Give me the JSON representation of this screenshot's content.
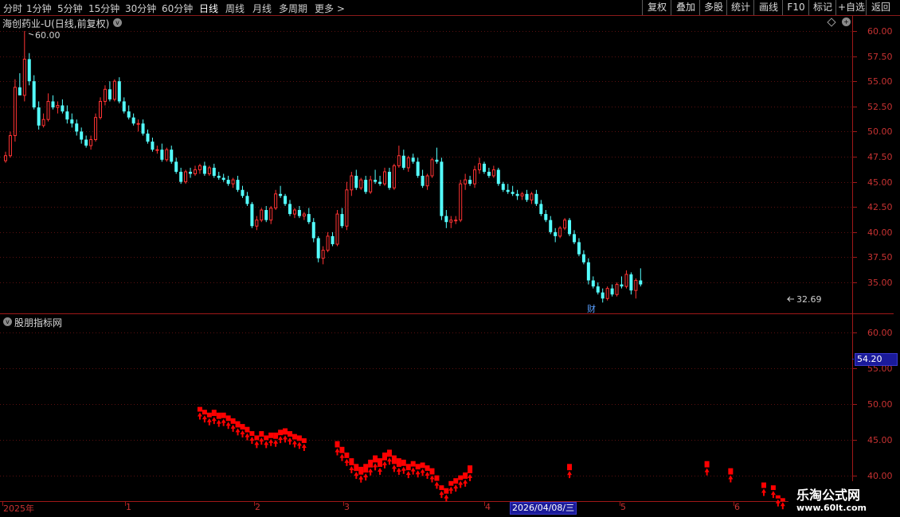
{
  "toolbar": {
    "periods": [
      "分时",
      "1分钟",
      "5分钟",
      "15分钟",
      "30分钟",
      "60分钟",
      "日线",
      "周线",
      "月线",
      "多周期",
      "更多 >"
    ],
    "active_period": "日线",
    "right_buttons": [
      "复权",
      "叠加",
      "多股",
      "统计",
      "画线",
      "F10",
      "标记",
      "+自选",
      "返回"
    ]
  },
  "stock": {
    "name": "海创药业-U(日线,前复权)"
  },
  "indicator": {
    "name": "股朋指标网"
  },
  "annotations": {
    "high": "60.00",
    "low": "32.69",
    "financial_mark": "财"
  },
  "crosshair": {
    "date": "2026/04/08/三",
    "value": "54.20"
  },
  "watermark": {
    "line1": "乐淘公式网",
    "line2": "www.60lt.com"
  },
  "colors": {
    "up": "#ff3333",
    "down": "#54ffff",
    "signal": "#ff0000",
    "axis": "#a01818"
  },
  "chart_data": [
    {
      "type": "candlestick",
      "title": "海创药业-U(日线,前复权)",
      "y_ticks": [
        60.0,
        57.5,
        55.0,
        52.5,
        50.0,
        47.5,
        45.0,
        42.5,
        40.0,
        37.5,
        35.0
      ],
      "ylim": [
        32.0,
        61.5
      ],
      "x_labels": [
        "2025年",
        "1",
        "2",
        "3",
        "4",
        "5",
        "6"
      ],
      "high": 60.0,
      "low": 32.69,
      "candles": [
        [
          47.1,
          48.0,
          46.9,
          47.6
        ],
        [
          47.6,
          50.0,
          47.4,
          49.6
        ],
        [
          49.6,
          55.2,
          49.0,
          54.4
        ],
        [
          54.4,
          55.8,
          53.6,
          53.6
        ],
        [
          53.6,
          60.0,
          53.0,
          57.2
        ],
        [
          57.2,
          57.8,
          54.6,
          55.0
        ],
        [
          55.0,
          55.6,
          52.2,
          52.4
        ],
        [
          52.4,
          53.0,
          50.2,
          50.6
        ],
        [
          50.6,
          51.8,
          50.4,
          51.2
        ],
        [
          51.2,
          53.8,
          51.0,
          53.0
        ],
        [
          53.0,
          53.6,
          52.2,
          52.4
        ],
        [
          52.4,
          53.0,
          51.8,
          52.6
        ],
        [
          52.6,
          53.2,
          51.8,
          52.0
        ],
        [
          52.0,
          52.6,
          50.8,
          51.2
        ],
        [
          51.2,
          51.8,
          50.4,
          50.8
        ],
        [
          50.8,
          51.2,
          49.6,
          50.0
        ],
        [
          50.0,
          50.4,
          48.8,
          49.2
        ],
        [
          49.2,
          49.6,
          48.4,
          48.6
        ],
        [
          48.6,
          49.6,
          48.2,
          49.2
        ],
        [
          49.2,
          51.8,
          49.0,
          51.4
        ],
        [
          51.4,
          53.4,
          51.2,
          53.0
        ],
        [
          53.0,
          54.6,
          52.6,
          54.2
        ],
        [
          54.2,
          55.0,
          53.0,
          53.2
        ],
        [
          53.2,
          55.2,
          53.0,
          55.0
        ],
        [
          55.0,
          55.4,
          52.8,
          53.0
        ],
        [
          53.0,
          53.4,
          51.8,
          52.0
        ],
        [
          52.0,
          52.6,
          51.2,
          51.4
        ],
        [
          51.4,
          51.8,
          50.6,
          50.8
        ],
        [
          50.8,
          51.2,
          50.0,
          50.8
        ],
        [
          50.8,
          51.2,
          49.6,
          49.8
        ],
        [
          49.8,
          50.2,
          48.8,
          49.0
        ],
        [
          49.0,
          49.4,
          48.0,
          48.2
        ],
        [
          48.2,
          48.6,
          47.8,
          48.2
        ],
        [
          48.2,
          48.8,
          47.0,
          47.2
        ],
        [
          47.2,
          48.4,
          47.0,
          48.2
        ],
        [
          48.2,
          48.6,
          46.8,
          47.0
        ],
        [
          47.0,
          47.4,
          45.8,
          46.0
        ],
        [
          46.0,
          46.4,
          44.8,
          45.0
        ],
        [
          45.0,
          46.2,
          44.8,
          46.0
        ],
        [
          46.0,
          46.4,
          45.4,
          45.8
        ],
        [
          45.8,
          46.6,
          45.6,
          46.2
        ],
        [
          46.2,
          46.8,
          45.8,
          46.6
        ],
        [
          46.6,
          47.0,
          45.6,
          45.8
        ],
        [
          45.8,
          46.6,
          45.6,
          46.4
        ],
        [
          46.4,
          46.8,
          45.4,
          45.6
        ],
        [
          45.6,
          46.0,
          45.2,
          45.4
        ],
        [
          45.4,
          45.8,
          45.0,
          45.2
        ],
        [
          45.2,
          45.6,
          44.6,
          44.8
        ],
        [
          44.8,
          45.4,
          44.4,
          45.2
        ],
        [
          45.2,
          45.6,
          44.0,
          44.2
        ],
        [
          44.2,
          44.6,
          43.4,
          43.6
        ],
        [
          43.6,
          44.0,
          42.6,
          42.8
        ],
        [
          42.8,
          43.0,
          40.4,
          40.6
        ],
        [
          40.6,
          41.6,
          40.2,
          41.2
        ],
        [
          41.2,
          42.4,
          41.0,
          42.2
        ],
        [
          42.2,
          42.6,
          41.0,
          41.2
        ],
        [
          41.2,
          42.6,
          40.8,
          42.4
        ],
        [
          42.4,
          44.2,
          42.2,
          43.8
        ],
        [
          43.8,
          44.6,
          43.4,
          43.6
        ],
        [
          43.6,
          43.8,
          42.6,
          42.8
        ],
        [
          42.8,
          43.2,
          41.6,
          41.8
        ],
        [
          41.8,
          42.4,
          41.4,
          42.2
        ],
        [
          42.2,
          42.6,
          41.4,
          41.6
        ],
        [
          41.6,
          42.0,
          41.2,
          41.8
        ],
        [
          41.8,
          42.4,
          40.8,
          41.0
        ],
        [
          41.0,
          41.4,
          39.0,
          39.4
        ],
        [
          39.4,
          39.6,
          37.0,
          37.4
        ],
        [
          37.4,
          38.6,
          36.8,
          38.2
        ],
        [
          38.2,
          40.0,
          38.0,
          39.6
        ],
        [
          39.6,
          40.0,
          38.6,
          38.8
        ],
        [
          38.8,
          42.2,
          38.6,
          41.8
        ],
        [
          41.8,
          42.4,
          40.4,
          40.6
        ],
        [
          40.6,
          45.0,
          40.2,
          44.2
        ],
        [
          44.2,
          46.0,
          43.6,
          45.6
        ],
        [
          45.6,
          46.2,
          44.2,
          44.4
        ],
        [
          44.4,
          45.4,
          44.2,
          45.2
        ],
        [
          45.2,
          45.6,
          43.8,
          44.0
        ],
        [
          44.0,
          45.6,
          43.8,
          45.2
        ],
        [
          45.2,
          46.2,
          44.8,
          45.0
        ],
        [
          45.0,
          45.6,
          44.6,
          44.8
        ],
        [
          44.8,
          46.4,
          44.6,
          46.0
        ],
        [
          46.0,
          46.4,
          44.2,
          44.4
        ],
        [
          44.4,
          46.8,
          44.2,
          46.6
        ],
        [
          46.6,
          48.6,
          46.4,
          47.6
        ],
        [
          47.6,
          48.2,
          46.2,
          46.4
        ],
        [
          46.4,
          47.6,
          46.0,
          47.4
        ],
        [
          47.4,
          47.8,
          46.8,
          47.0
        ],
        [
          47.0,
          47.4,
          45.4,
          45.6
        ],
        [
          45.6,
          46.2,
          44.4,
          44.6
        ],
        [
          44.6,
          45.8,
          44.2,
          45.6
        ],
        [
          45.6,
          47.4,
          45.4,
          47.2
        ],
        [
          47.2,
          48.4,
          46.8,
          47.0
        ],
        [
          47.0,
          47.4,
          41.2,
          41.6
        ],
        [
          41.6,
          42.2,
          40.4,
          41.0
        ],
        [
          41.0,
          41.6,
          40.4,
          41.2
        ],
        [
          41.2,
          41.6,
          40.8,
          41.2
        ],
        [
          41.2,
          45.2,
          41.0,
          44.8
        ],
        [
          44.8,
          45.8,
          44.2,
          45.2
        ],
        [
          45.2,
          45.6,
          44.6,
          44.8
        ],
        [
          44.8,
          46.6,
          44.4,
          46.2
        ],
        [
          46.2,
          47.4,
          45.8,
          46.8
        ],
        [
          46.8,
          47.0,
          45.8,
          46.0
        ],
        [
          46.0,
          46.4,
          45.4,
          45.6
        ],
        [
          45.6,
          46.6,
          45.4,
          46.2
        ],
        [
          46.2,
          46.4,
          44.6,
          44.8
        ],
        [
          44.8,
          45.0,
          44.0,
          44.2
        ],
        [
          44.2,
          44.8,
          43.8,
          44.0
        ],
        [
          44.0,
          44.6,
          43.6,
          43.8
        ],
        [
          43.8,
          44.2,
          43.2,
          43.6
        ],
        [
          43.6,
          44.0,
          43.2,
          43.8
        ],
        [
          43.8,
          44.2,
          43.0,
          43.2
        ],
        [
          43.2,
          44.0,
          42.8,
          43.8
        ],
        [
          43.8,
          44.2,
          42.6,
          42.8
        ],
        [
          42.8,
          43.2,
          41.6,
          41.8
        ],
        [
          41.8,
          42.2,
          41.0,
          41.2
        ],
        [
          41.2,
          41.6,
          39.8,
          40.0
        ],
        [
          40.0,
          40.4,
          39.0,
          39.6
        ],
        [
          39.6,
          40.6,
          39.4,
          40.4
        ],
        [
          40.4,
          41.4,
          40.2,
          41.2
        ],
        [
          41.2,
          41.4,
          39.6,
          39.8
        ],
        [
          39.8,
          40.2,
          38.8,
          39.0
        ],
        [
          39.0,
          39.4,
          37.6,
          37.8
        ],
        [
          37.8,
          38.2,
          36.8,
          37.0
        ],
        [
          37.0,
          37.4,
          34.8,
          35.2
        ],
        [
          35.2,
          35.6,
          34.4,
          34.6
        ],
        [
          34.6,
          35.0,
          33.8,
          34.0
        ],
        [
          34.0,
          34.4,
          33.0,
          33.4
        ],
        [
          33.4,
          34.6,
          33.2,
          34.4
        ],
        [
          34.4,
          34.8,
          33.6,
          33.8
        ],
        [
          33.8,
          35.0,
          33.6,
          34.8
        ],
        [
          34.8,
          35.6,
          34.4,
          34.6
        ],
        [
          34.6,
          36.2,
          34.4,
          35.8
        ],
        [
          35.8,
          36.0,
          33.8,
          34.2
        ],
        [
          34.2,
          35.4,
          33.4,
          35.2
        ],
        [
          35.2,
          36.4,
          34.6,
          34.8
        ]
      ]
    },
    {
      "type": "signal",
      "title": "股朋指标网",
      "y_ticks": [
        60.0,
        55.0,
        50.0,
        45.0,
        40.0
      ],
      "ylim": [
        36.5,
        62.5
      ],
      "marks": [
        [
          41,
          49.6,
          48.4
        ],
        [
          42,
          49.2,
          48.0
        ],
        [
          43,
          48.8,
          47.6
        ],
        [
          44,
          49.2,
          47.6
        ],
        [
          45,
          48.8,
          47.2
        ],
        [
          46,
          48.8,
          47.4
        ],
        [
          47,
          48.4,
          47.0
        ],
        [
          48,
          48.0,
          46.6
        ],
        [
          49,
          47.6,
          46.0
        ],
        [
          50,
          47.2,
          45.8
        ],
        [
          51,
          46.8,
          45.4
        ],
        [
          52,
          46.2,
          45.0
        ],
        [
          53,
          45.6,
          44.4
        ],
        [
          54,
          46.2,
          44.8
        ],
        [
          55,
          45.6,
          44.4
        ],
        [
          56,
          46.0,
          44.6
        ],
        [
          57,
          46.0,
          44.4
        ],
        [
          58,
          46.4,
          45.0
        ],
        [
          59,
          46.6,
          45.0
        ],
        [
          60,
          46.2,
          44.8
        ],
        [
          61,
          45.8,
          44.4
        ],
        [
          62,
          45.6,
          44.2
        ],
        [
          63,
          45.2,
          44.0
        ],
        [
          70,
          44.8,
          43.2
        ],
        [
          71,
          44.0,
          42.4
        ],
        [
          72,
          43.2,
          41.8
        ],
        [
          73,
          42.4,
          40.6
        ],
        [
          74,
          41.6,
          39.8
        ],
        [
          75,
          41.2,
          39.2
        ],
        [
          76,
          41.6,
          39.4
        ],
        [
          77,
          42.2,
          40.2
        ],
        [
          78,
          42.8,
          41.0
        ],
        [
          79,
          42.4,
          40.2
        ],
        [
          80,
          43.2,
          41.2
        ],
        [
          81,
          43.6,
          41.8
        ],
        [
          82,
          42.8,
          40.6
        ],
        [
          83,
          42.4,
          40.2
        ],
        [
          84,
          42.2,
          40.6
        ],
        [
          85,
          41.6,
          40.0
        ],
        [
          86,
          42.0,
          40.6
        ],
        [
          87,
          41.6,
          40.2
        ],
        [
          88,
          41.8,
          40.4
        ],
        [
          89,
          41.4,
          40.0
        ],
        [
          90,
          41.0,
          39.4
        ],
        [
          91,
          40.0,
          38.6
        ],
        [
          92,
          38.6,
          37.4
        ],
        [
          93,
          38.2,
          36.8
        ],
        [
          94,
          39.2,
          38.0
        ],
        [
          95,
          39.6,
          38.2
        ],
        [
          96,
          40.0,
          38.8
        ],
        [
          97,
          40.4,
          38.8
        ],
        [
          98,
          41.4,
          39.4
        ],
        [
          119,
          41.6,
          40.0
        ],
        [
          148,
          42.0,
          40.4
        ],
        [
          153,
          41.0,
          39.4
        ],
        [
          160,
          39.0,
          37.6
        ],
        [
          162,
          38.6,
          37.4
        ],
        [
          163,
          37.2,
          36.6
        ],
        [
          164,
          36.8,
          36.2
        ]
      ]
    }
  ]
}
